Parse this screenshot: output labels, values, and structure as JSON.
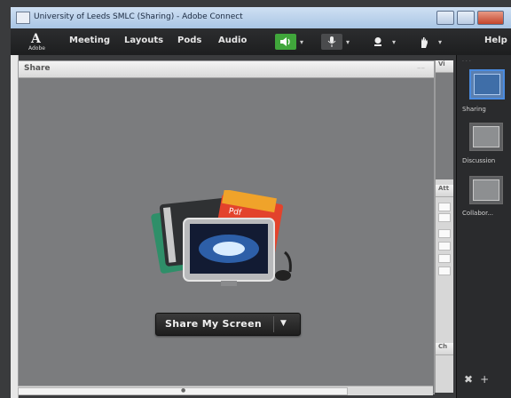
{
  "window": {
    "title": "University of Leeds SMLC (Sharing) - Adobe Connect"
  },
  "menubar": {
    "logo_letter": "A",
    "logo_text": "Adobe",
    "items": [
      "Meeting",
      "Layouts",
      "Pods",
      "Audio"
    ],
    "help": "Help",
    "icons": [
      "speaker-icon",
      "microphone-icon",
      "webcam-icon",
      "raise-hand-icon"
    ]
  },
  "share_pod": {
    "title": "Share",
    "button_label": "Share My Screen"
  },
  "side_pods": {
    "top_header": "Vi",
    "mid_header": "Att",
    "bottom_header": "Ch"
  },
  "layouts_panel": {
    "items": [
      {
        "label": "Sharing",
        "selected": true
      },
      {
        "label": "Discussion",
        "selected": false
      },
      {
        "label": "Collabor...",
        "selected": false
      }
    ]
  },
  "colors": {
    "accent_selected": "#4a8be0",
    "speaker_on": "#40a63b"
  }
}
